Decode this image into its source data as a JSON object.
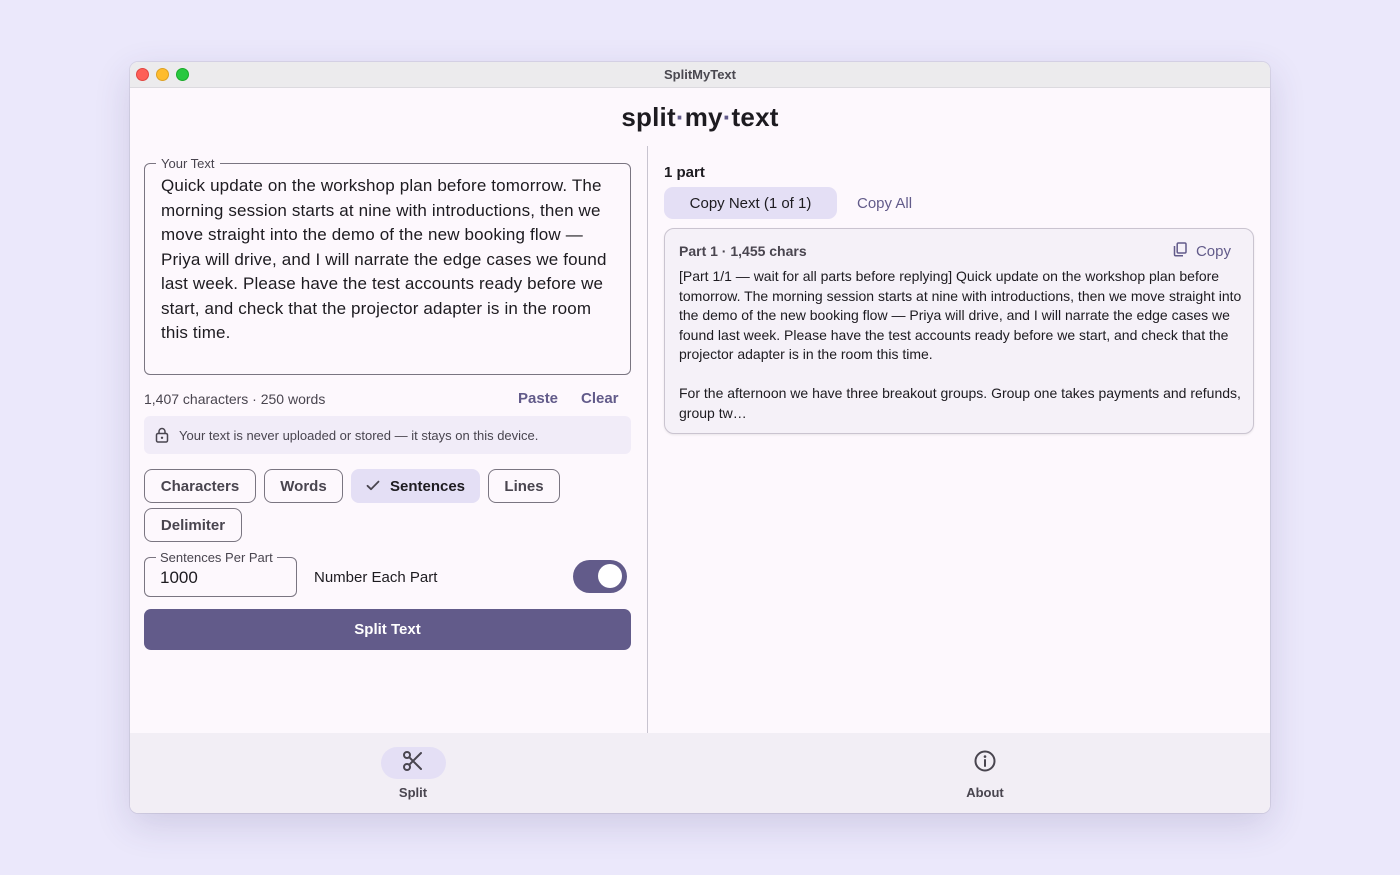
{
  "window": {
    "title": "SplitMyText"
  },
  "header": {
    "brand_parts": [
      "split",
      "·",
      "my",
      "·",
      "text"
    ]
  },
  "input": {
    "label": "Your Text",
    "text": "Quick update on the workshop plan before tomorrow. The morning session starts at nine with introductions, then we move straight into the demo of the new booking flow — Priya will drive, and I will narrate the edge cases we found last week. Please have the test accounts ready before we start, and check that the projector adapter is in the room this time.",
    "stats": "1,407 characters · 250 words",
    "paste_label": "Paste",
    "clear_label": "Clear"
  },
  "privacy": {
    "text": "Your text is never uploaded or stored — it stays on this device.",
    "icon": "lock-icon"
  },
  "split_modes": {
    "selected": "Sentences",
    "items": [
      "Characters",
      "Words",
      "Sentences",
      "Lines",
      "Delimiter"
    ]
  },
  "options": {
    "per_part_label": "Sentences Per Part",
    "per_part_value": "1000",
    "number_parts_label": "Number Each Part",
    "number_parts_on": true
  },
  "split_button": "Split Text",
  "results": {
    "count_label": "1 part",
    "copy_next_label": "Copy Next (1 of 1)",
    "copy_all_label": "Copy All",
    "parts": [
      {
        "header": "Part 1 · 1,455 chars",
        "copy_label": "Copy",
        "body": "[Part 1/1 — wait for all parts before replying] Quick update on the workshop plan before tomorrow. The morning session starts at nine with introductions, then we move straight into the demo of the new booking flow — Priya will drive, and I will narrate the edge cases we found last week. Please have the test accounts ready before we start, and check that the projector adapter is in the room this time.\n\nFor the afternoon we have three breakout groups. Group one takes payments and refunds, group tw…"
      }
    ]
  },
  "nav": {
    "items": [
      {
        "label": "Split",
        "icon": "scissors-icon",
        "active": true
      },
      {
        "label": "About",
        "icon": "info-icon",
        "active": false
      }
    ]
  },
  "colors": {
    "primary": "#625b8a",
    "selected_container": "#e4dff5",
    "background": "#fdf8fd",
    "desktop": "#ebe8fb"
  }
}
